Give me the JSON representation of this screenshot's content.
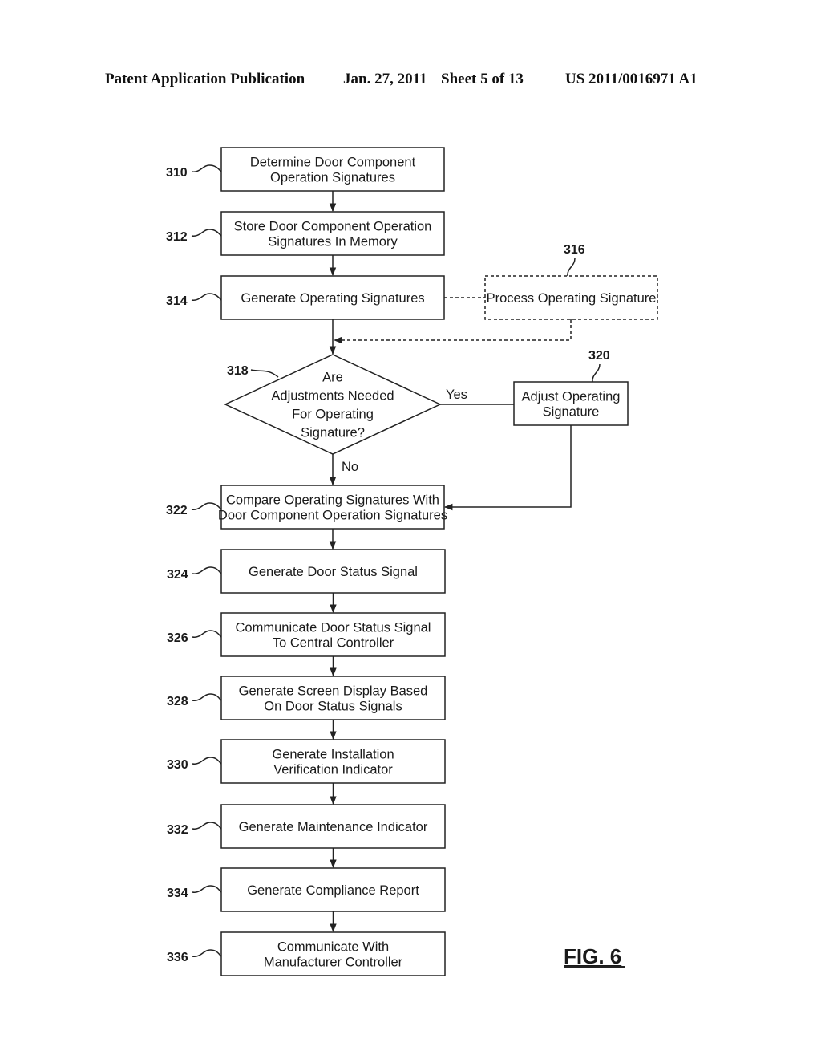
{
  "header": {
    "publication": "Patent Application Publication",
    "date": "Jan. 27, 2011",
    "sheet": "Sheet 5 of 13",
    "number": "US 2011/0016971 A1"
  },
  "figure": {
    "label": "FIG. 6"
  },
  "nodes": [
    {
      "id": "310",
      "ref": "310",
      "type": "process",
      "lines": [
        "Determine Door Component",
        "Operation Signatures"
      ]
    },
    {
      "id": "312",
      "ref": "312",
      "type": "process",
      "lines": [
        "Store Door Component Operation",
        "Signatures In Memory"
      ]
    },
    {
      "id": "314",
      "ref": "314",
      "type": "process",
      "lines": [
        "Generate Operating Signatures"
      ]
    },
    {
      "id": "316",
      "ref": "316",
      "type": "optional-process",
      "lines": [
        "Process Operating Signature"
      ]
    },
    {
      "id": "318",
      "ref": "318",
      "type": "decision",
      "lines": [
        "Are",
        "Adjustments Needed",
        "For Operating",
        "Signature?"
      ]
    },
    {
      "id": "320",
      "ref": "320",
      "type": "process",
      "lines": [
        "Adjust Operating",
        "Signature"
      ]
    },
    {
      "id": "322",
      "ref": "322",
      "type": "process",
      "lines": [
        "Compare Operating Signatures With",
        "Door Component Operation Signatures"
      ]
    },
    {
      "id": "324",
      "ref": "324",
      "type": "process",
      "lines": [
        "Generate Door Status Signal"
      ]
    },
    {
      "id": "326",
      "ref": "326",
      "type": "process",
      "lines": [
        "Communicate Door Status Signal",
        "To Central Controller"
      ]
    },
    {
      "id": "328",
      "ref": "328",
      "type": "process",
      "lines": [
        "Generate Screen Display Based",
        "On Door Status Signals"
      ]
    },
    {
      "id": "330",
      "ref": "330",
      "type": "process",
      "lines": [
        "Generate Installation",
        "Verification Indicator"
      ]
    },
    {
      "id": "332",
      "ref": "332",
      "type": "process",
      "lines": [
        "Generate Maintenance Indicator"
      ]
    },
    {
      "id": "334",
      "ref": "334",
      "type": "process",
      "lines": [
        "Generate Compliance Report"
      ]
    },
    {
      "id": "336",
      "ref": "336",
      "type": "process",
      "lines": [
        "Communicate With",
        "Manufacturer Controller"
      ]
    }
  ],
  "edges": [
    {
      "from": "310",
      "to": "312",
      "style": "solid"
    },
    {
      "from": "312",
      "to": "314",
      "style": "solid"
    },
    {
      "from": "314",
      "to": "316",
      "style": "dashed"
    },
    {
      "from": "316",
      "to": "318",
      "style": "dashed"
    },
    {
      "from": "314",
      "to": "318",
      "style": "solid"
    },
    {
      "from": "318",
      "to": "320",
      "style": "solid",
      "label": "Yes"
    },
    {
      "from": "318",
      "to": "322",
      "style": "solid",
      "label": "No"
    },
    {
      "from": "320",
      "to": "322",
      "style": "solid"
    },
    {
      "from": "322",
      "to": "324",
      "style": "solid"
    },
    {
      "from": "324",
      "to": "326",
      "style": "solid"
    },
    {
      "from": "326",
      "to": "328",
      "style": "solid"
    },
    {
      "from": "328",
      "to": "330",
      "style": "solid"
    },
    {
      "from": "330",
      "to": "332",
      "style": "solid"
    },
    {
      "from": "332",
      "to": "334",
      "style": "solid"
    },
    {
      "from": "334",
      "to": "336",
      "style": "solid"
    }
  ]
}
